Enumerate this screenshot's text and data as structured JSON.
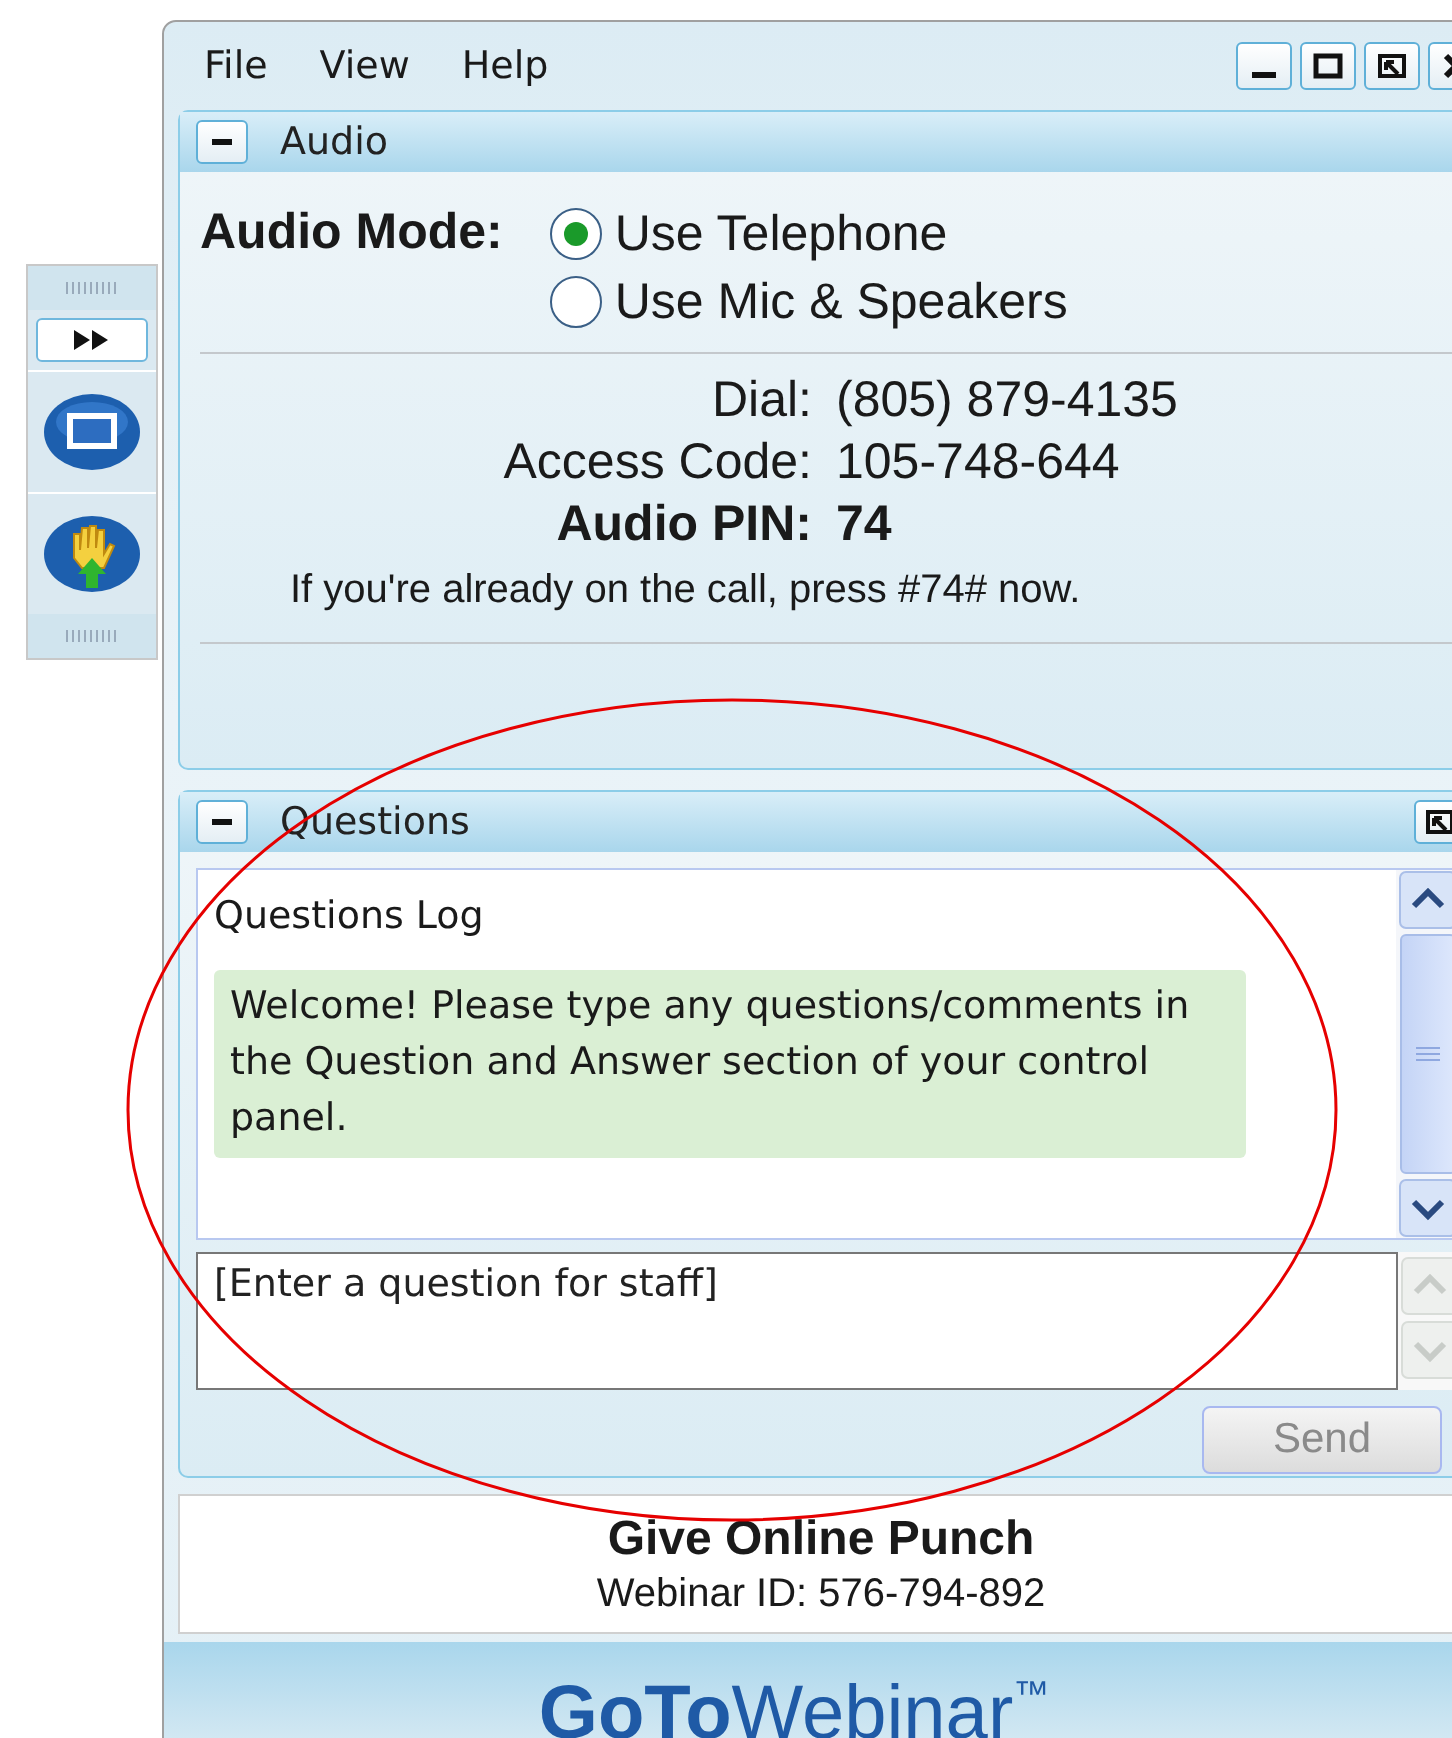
{
  "menu": [
    "File",
    "View",
    "Help"
  ],
  "audio": {
    "title": "Audio",
    "expanded": true,
    "mode_label": "Audio Mode:",
    "options": [
      {
        "label": "Use Telephone",
        "selected": true
      },
      {
        "label": "Use Mic & Speakers",
        "selected": false
      }
    ],
    "details": [
      {
        "label": "Dial:",
        "value": "(805) 879-4135",
        "emphasis": false
      },
      {
        "label": "Access Code:",
        "value": "105-748-644",
        "emphasis": false
      },
      {
        "label": "Audio PIN:",
        "value": "74",
        "emphasis": true
      }
    ],
    "note": "If you're already on the call, press #74# now."
  },
  "questions": {
    "title": "Questions",
    "expanded": true,
    "log_title": "Questions Log",
    "messages": [
      "Welcome! Please type any questions/comments in the Question and Answer section of your control panel."
    ],
    "placeholder": "[Enter a question for staff]",
    "send": {
      "label": "Send",
      "disabled": true
    }
  },
  "session": {
    "title": "Give Online Punch",
    "webinar_id": "Webinar ID: 576-794-892"
  },
  "brand": "**GoTo**Webinar$^{™}$"
}
